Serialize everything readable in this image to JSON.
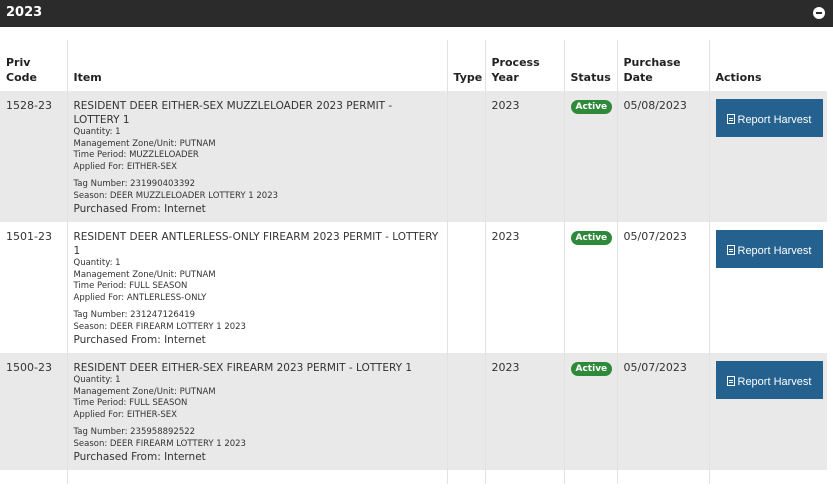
{
  "panel": {
    "title": "2023"
  },
  "columns": {
    "priv_code": "Priv Code",
    "item": "Item",
    "type": "Type",
    "process_year": "Process Year",
    "status": "Status",
    "purchase_date": "Purchase Date",
    "actions": "Actions"
  },
  "rows": [
    {
      "priv_code": "1528-23",
      "title": "RESIDENT DEER EITHER-SEX MUZZLELOADER 2023 PERMIT - LOTTERY 1",
      "quantity": "Quantity: 1",
      "zone": "Management Zone/Unit: PUTNAM",
      "period": "Time Period: MUZZLELOADER",
      "applied": "Applied For: EITHER-SEX",
      "tag": "Tag Number: 231990403392",
      "season": "Season: DEER MUZZLELOADER LOTTERY 1 2023",
      "purchased": "Purchased From: Internet",
      "type": "",
      "process_year": "2023",
      "status": "Active",
      "purchase_date": "05/08/2023",
      "action_label": "Report Harvest"
    },
    {
      "priv_code": "1501-23",
      "title": "RESIDENT DEER ANTLERLESS-ONLY FIREARM 2023 PERMIT - LOTTERY 1",
      "quantity": "Quantity: 1",
      "zone": "Management Zone/Unit: PUTNAM",
      "period": "Time Period: FULL SEASON",
      "applied": "Applied For: ANTLERLESS-ONLY",
      "tag": "Tag Number: 231247126419",
      "season": "Season: DEER FIREARM LOTTERY 1 2023",
      "purchased": "Purchased From: Internet",
      "type": "",
      "process_year": "2023",
      "status": "Active",
      "purchase_date": "05/07/2023",
      "action_label": "Report Harvest"
    },
    {
      "priv_code": "1500-23",
      "title": "RESIDENT DEER EITHER-SEX FIREARM 2023 PERMIT - LOTTERY 1",
      "quantity": "Quantity: 1",
      "zone": "Management Zone/Unit: PUTNAM",
      "period": "Time Period: FULL SEASON",
      "applied": "Applied For: EITHER-SEX",
      "tag": "Tag Number: 235958892522",
      "season": "Season: DEER FIREARM LOTTERY 1 2023",
      "purchased": "Purchased From: Internet",
      "type": "",
      "process_year": "2023",
      "status": "Active",
      "purchase_date": "05/07/2023",
      "action_label": "Report Harvest"
    }
  ],
  "colors": {
    "header_bg": "#2b2b2b",
    "status_active": "#2e8a3a",
    "button_bg": "#24618f",
    "row_alt": "#e9e9e9"
  },
  "icons": {
    "collapse": "minus-circle-icon",
    "report": "document-icon"
  }
}
